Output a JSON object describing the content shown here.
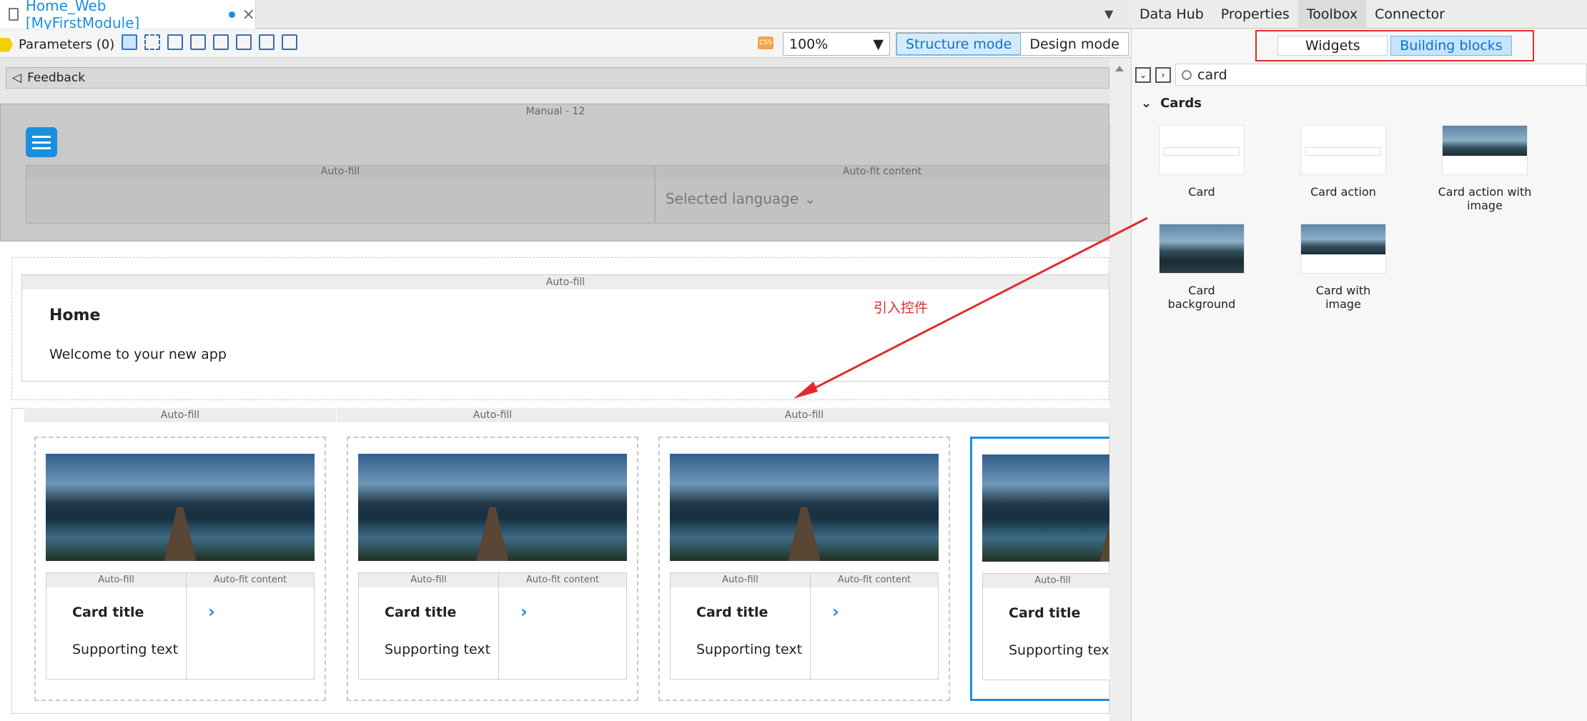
{
  "editor_tab": {
    "title": "Home_Web [MyFirstModule]"
  },
  "right_tabs": [
    "Data Hub",
    "Properties",
    "Toolbox",
    "Connector"
  ],
  "toolbar": {
    "parameters": "Parameters (0)",
    "zoom": "100%",
    "structure_mode": "Structure mode",
    "design_mode": "Design mode",
    "css_icon": "CSS"
  },
  "toolbox": {
    "segments": {
      "widgets": "Widgets",
      "building_blocks": "Building blocks"
    },
    "search_value": "card",
    "category": "Cards",
    "items": [
      "Card",
      "Card action",
      "Card action with image",
      "Card background",
      "Card with image"
    ]
  },
  "canvas": {
    "feedback": "Feedback",
    "header_label": "Manual - 12",
    "auto_fill": "Auto-fill",
    "auto_fit": "Auto-fit content",
    "auto_truncated": "Au",
    "selected_language": "Selected language",
    "home_title": "Home",
    "welcome": "Welcome to your new app",
    "cards": [
      {
        "title": "Card title",
        "text": "Supporting text"
      },
      {
        "title": "Card title",
        "text": "Supporting text"
      },
      {
        "title": "Card title",
        "text": "Supporting text"
      },
      {
        "title": "Card title",
        "text": "Supporting text"
      }
    ]
  },
  "annotation": "引入控件",
  "colors": {
    "accent": "#1a8fe0",
    "highlight_box": "#e12b2b"
  }
}
